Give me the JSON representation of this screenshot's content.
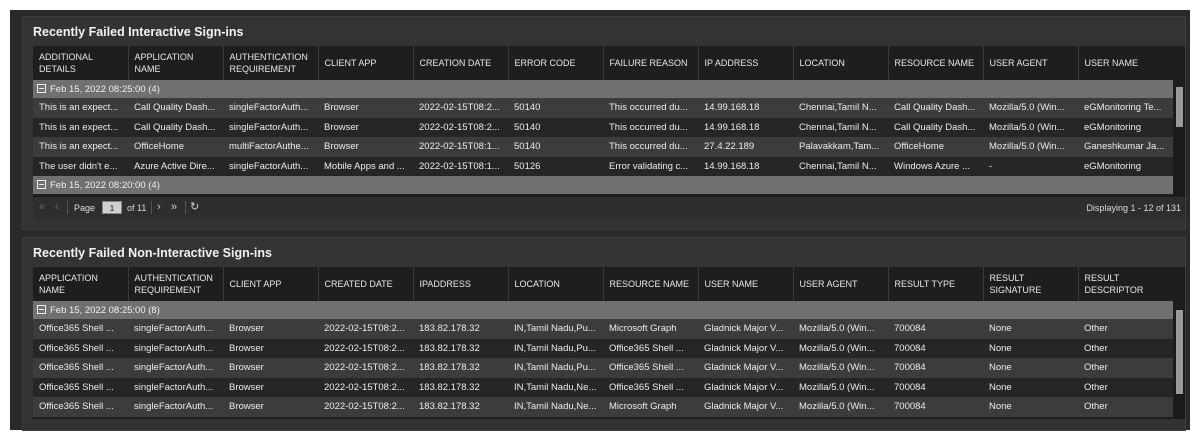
{
  "panel1": {
    "title": "Recently Failed Interactive Sign-ins",
    "columns": [
      "ADDITIONAL DETAILS",
      "APPLICATION NAME",
      "AUTHENTICATION REQUIREMENT",
      "CLIENT APP",
      "CREATION DATE",
      "ERROR CODE",
      "FAILURE REASON",
      "IP ADDRESS",
      "LOCATION",
      "RESOURCE NAME",
      "USER AGENT",
      "USER NAME"
    ],
    "group1": "Feb 15, 2022 08:25:00 (4)",
    "rows": [
      [
        "This is an expect...",
        "Call Quality Dash...",
        "singleFactorAuth...",
        "Browser",
        "2022-02-15T08:2...",
        "50140",
        "This occurred du...",
        "14.99.168.18",
        "Chennai,Tamil N...",
        "Call Quality Dash...",
        "Mozilla/5.0 (Win...",
        "eGMonitoring Te..."
      ],
      [
        "This is an expect...",
        "Call Quality Dash...",
        "singleFactorAuth...",
        "Browser",
        "2022-02-15T08:2...",
        "50140",
        "This occurred du...",
        "14.99.168.18",
        "Chennai,Tamil N...",
        "Call Quality Dash...",
        "Mozilla/5.0 (Win...",
        "eGMonitoring"
      ],
      [
        "This is an expect...",
        "OfficeHome",
        "multiFactorAuthe...",
        "Browser",
        "2022-02-15T08:1...",
        "50140",
        "This occurred du...",
        "27.4.22.189",
        "Palavakkam,Tam...",
        "OfficeHome",
        "Mozilla/5.0 (Win...",
        "Ganeshkumar Ja..."
      ],
      [
        "The user didn't e...",
        "Azure Active Dire...",
        "singleFactorAuth...",
        "Mobile Apps and ...",
        "2022-02-15T08:1...",
        "50126",
        "Error validating c...",
        "14.99.168.18",
        "Chennai,Tamil N...",
        "Windows Azure ...",
        "-",
        "eGMonitoring"
      ]
    ],
    "group2": "Feb 15, 2022 08:20:00 (4)",
    "pager": {
      "page_label": "Page",
      "page_value": "1",
      "of_label": "of 11",
      "display": "Displaying 1 - 12 of 131"
    },
    "scroll_position": 0.0
  },
  "panel2": {
    "title": "Recently Failed Non-Interactive Sign-ins",
    "columns": [
      "APPLICATION NAME",
      "AUTHENTICATION REQUIREMENT",
      "CLIENT APP",
      "CREATED DATE",
      "IPADDRESS",
      "LOCATION",
      "RESOURCE NAME",
      "USER NAME",
      "USER AGENT",
      "RESULT TYPE",
      "RESULT SIGNATURE",
      "RESULT DESCRIPTOR"
    ],
    "group1": "Feb 15, 2022 08:25:00 (8)",
    "rows": [
      [
        "Office365 Shell ...",
        "singleFactorAuth...",
        "Browser",
        "2022-02-15T08:2...",
        "183.82.178.32",
        "IN,Tamil Nadu,Pu...",
        "Microsoft Graph",
        "Gladnick Major V...",
        "Mozilla/5.0 (Win...",
        "700084",
        "None",
        "Other"
      ],
      [
        "Office365 Shell ...",
        "singleFactorAuth...",
        "Browser",
        "2022-02-15T08:2...",
        "183.82.178.32",
        "IN,Tamil Nadu,Pu...",
        "Office365 Shell ...",
        "Gladnick Major V...",
        "Mozilla/5.0 (Win...",
        "700084",
        "None",
        "Other"
      ],
      [
        "Office365 Shell ...",
        "singleFactorAuth...",
        "Browser",
        "2022-02-15T08:2...",
        "183.82.178.32",
        "IN,Tamil Nadu,Pu...",
        "Office365 Shell ...",
        "Gladnick Major V...",
        "Mozilla/5.0 (Win...",
        "700084",
        "None",
        "Other"
      ],
      [
        "Office365 Shell ...",
        "singleFactorAuth...",
        "Browser",
        "2022-02-15T08:2...",
        "183.82.178.32",
        "IN,Tamil Nadu,Ne...",
        "Office365 Shell ...",
        "Gladnick Major V...",
        "Mozilla/5.0 (Win...",
        "700084",
        "None",
        "Other"
      ],
      [
        "Office365 Shell ...",
        "singleFactorAuth...",
        "Browser",
        "2022-02-15T08:2...",
        "183.82.178.32",
        "IN,Tamil Nadu,Ne...",
        "Microsoft Graph",
        "Gladnick Major V...",
        "Mozilla/5.0 (Win...",
        "700084",
        "None",
        "Other"
      ]
    ],
    "scroll_position": 0.0
  },
  "icons": {
    "first": "double-chevron-left-icon",
    "prev": "chevron-left-icon",
    "next": "chevron-right-icon",
    "last": "double-chevron-right-icon",
    "refresh": "refresh-icon",
    "collapse": "collapse-group-icon"
  }
}
